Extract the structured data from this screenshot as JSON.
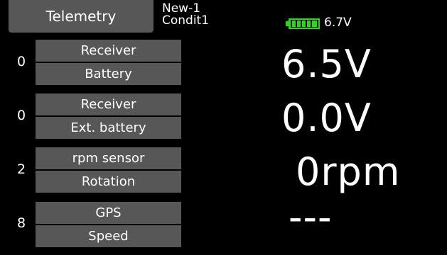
{
  "header": {
    "title": "Telemetry",
    "model_name": "New-1",
    "condition_name": "Condit1",
    "tx_battery": {
      "voltage": "6.7V",
      "level_fraction": 1.0,
      "color": "#22dd11",
      "icon": "battery-icon"
    }
  },
  "rows": [
    {
      "slot": "0",
      "device": "Receiver",
      "item": "Battery",
      "value": "6.5V"
    },
    {
      "slot": "0",
      "device": "Receiver",
      "item": "Ext. battery",
      "value": "0.0V"
    },
    {
      "slot": "2",
      "device": "rpm sensor",
      "item": "Rotation",
      "value": "0rpm"
    },
    {
      "slot": "8",
      "device": "GPS",
      "item": "Speed",
      "value": "---"
    }
  ],
  "colors": {
    "background": "#000000",
    "button": "#575757",
    "text": "#ffffff"
  }
}
